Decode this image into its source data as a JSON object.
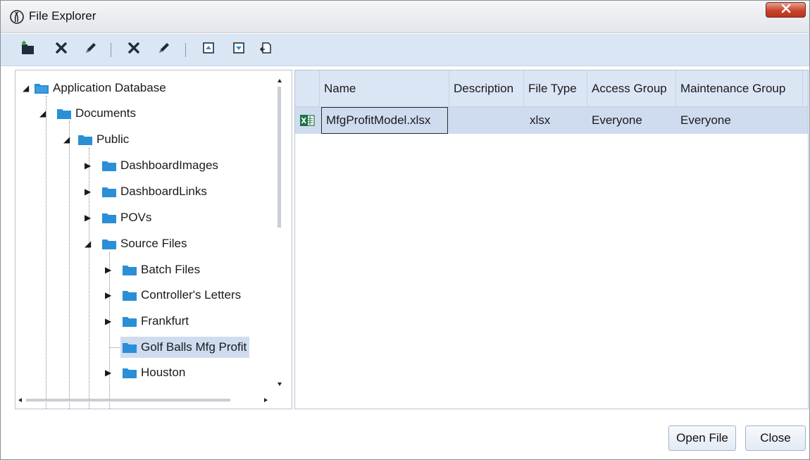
{
  "window": {
    "title": "File Explorer",
    "app_icon": "onestream-logo-icon",
    "close_icon": "close-icon"
  },
  "toolbar": {
    "buttons": [
      {
        "name": "create-folder",
        "icon": "new-folder-icon"
      },
      {
        "name": "delete-folder",
        "icon": "delete-icon"
      },
      {
        "name": "rename-folder",
        "icon": "pencil-icon"
      },
      {
        "name": "delete-file",
        "icon": "delete-icon"
      },
      {
        "name": "edit-file",
        "icon": "pencil-icon"
      },
      {
        "name": "upload-file",
        "icon": "upload-icon"
      },
      {
        "name": "download-file",
        "icon": "download-icon"
      },
      {
        "name": "extract-file",
        "icon": "export-icon"
      }
    ]
  },
  "tree": {
    "items": [
      {
        "label": "Application Database",
        "expanded": true
      },
      {
        "label": "Documents",
        "expanded": true
      },
      {
        "label": "Public",
        "expanded": true
      },
      {
        "label": "DashboardImages",
        "expanded": false
      },
      {
        "label": "DashboardLinks",
        "expanded": false
      },
      {
        "label": "POVs",
        "expanded": false
      },
      {
        "label": "Source Files",
        "expanded": true
      },
      {
        "label": "Batch Files",
        "expanded": false
      },
      {
        "label": "Controller's Letters",
        "expanded": false
      },
      {
        "label": "Frankfurt",
        "expanded": false
      },
      {
        "label": "Golf Balls Mfg Profit",
        "selected": true
      },
      {
        "label": "Houston",
        "expanded": false
      }
    ]
  },
  "grid": {
    "columns": [
      "Name",
      "Description",
      "File Type",
      "Access Group",
      "Maintenance Group"
    ],
    "rows": [
      {
        "icon": "excel-file-icon",
        "name": "MfgProfitModel.xlsx",
        "description": "",
        "file_type": "xlsx",
        "access_group": "Everyone",
        "maintenance_group": "Everyone"
      }
    ]
  },
  "footer": {
    "open_label": "Open File",
    "close_label": "Close"
  },
  "colors": {
    "toolbar_bg": "#dbe6f5",
    "selection": "#cfdcf0",
    "folder": "#2a8fd6",
    "excel": "#1e7145",
    "title_close": "#c8452c"
  }
}
